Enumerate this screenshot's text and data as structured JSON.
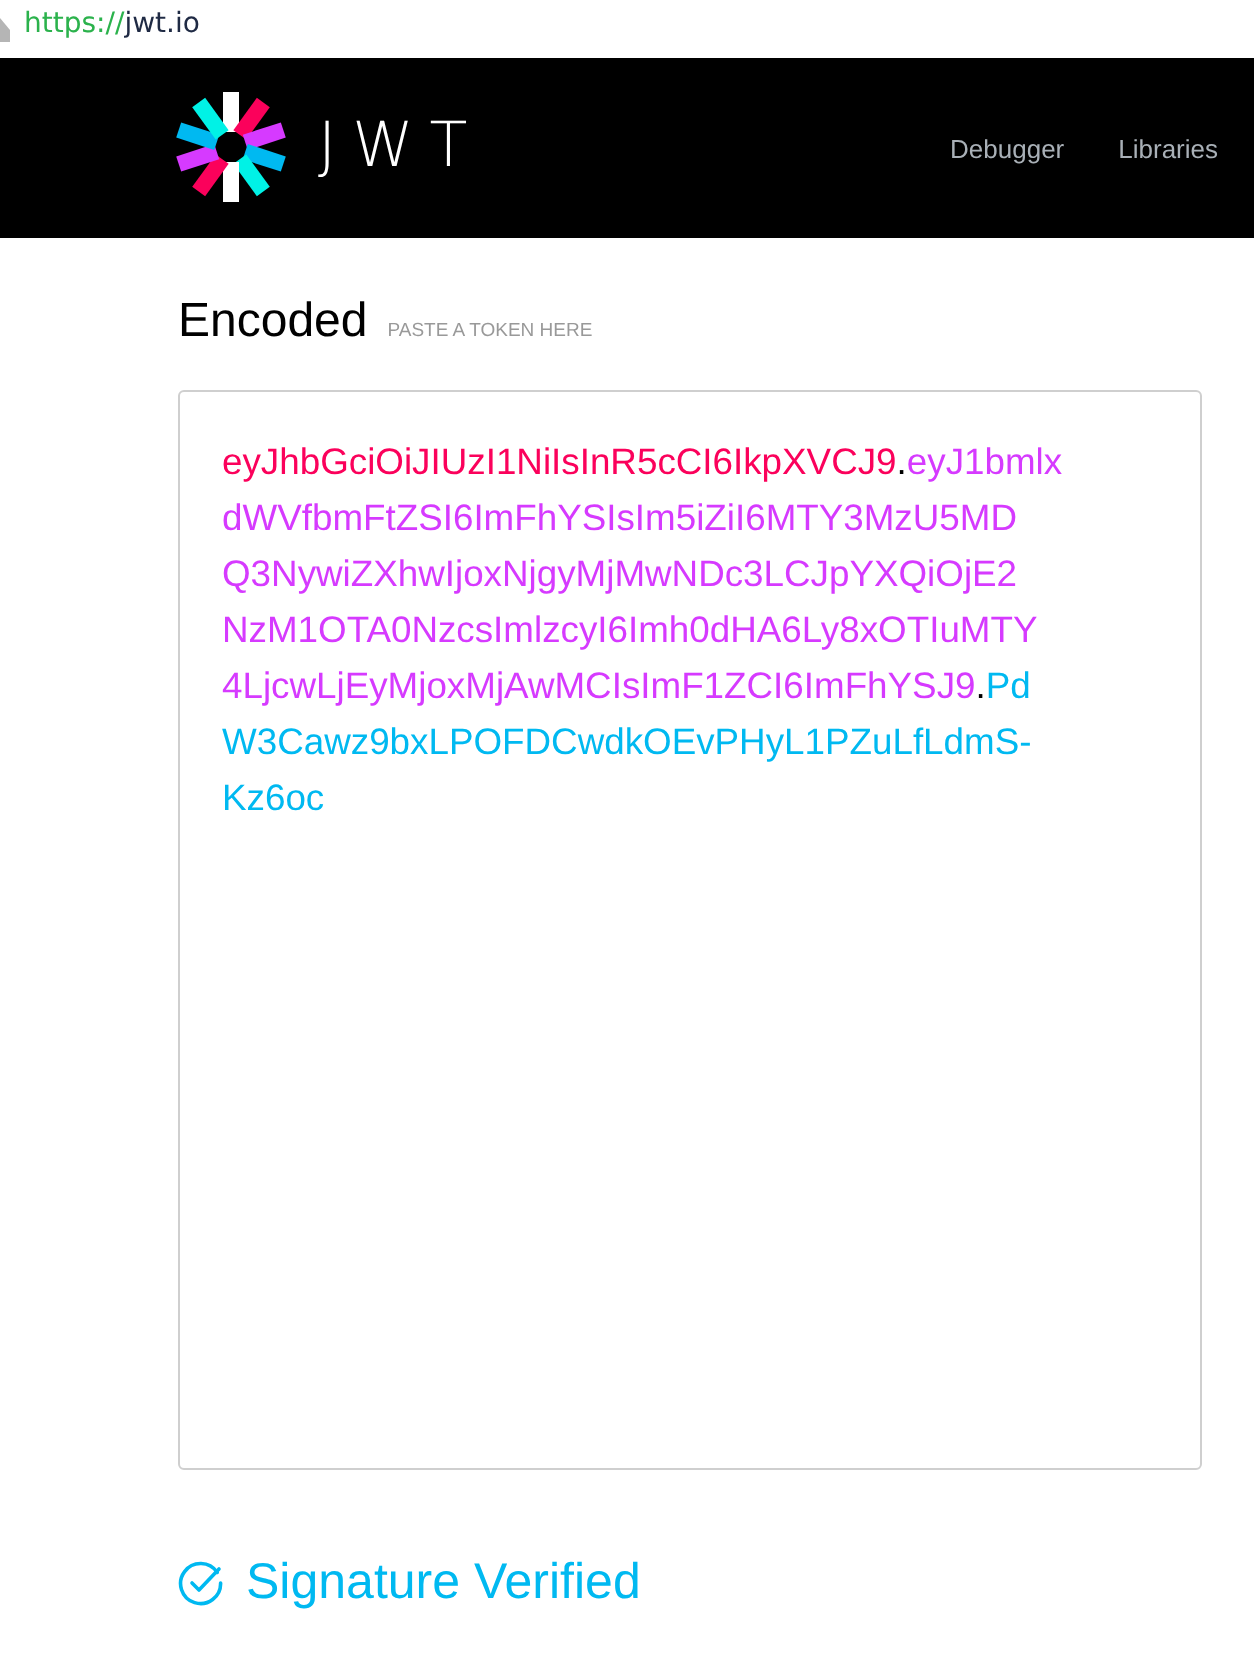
{
  "address_bar": {
    "scheme": "https://",
    "host": "jwt.io"
  },
  "header": {
    "logo_text": "JWT",
    "nav": [
      {
        "label": "Debugger"
      },
      {
        "label": "Libraries"
      }
    ]
  },
  "encoded": {
    "title": "Encoded",
    "hint": "PASTE A TOKEN HERE",
    "lines": [
      [
        {
          "color": "#fb015b",
          "text": "eyJhbGciOiJIUzI1NiIsInR5cCI6IkpXVCJ9"
        },
        {
          "color": "#000000",
          "text": "."
        },
        {
          "color": "#d63aff",
          "text": "eyJ1bmlx"
        }
      ],
      [
        {
          "color": "#d63aff",
          "text": "dWVfbmFtZSI6ImFhYSIsIm5iZiI6MTY3MzU5MD"
        }
      ],
      [
        {
          "color": "#d63aff",
          "text": "Q3NywiZXhwIjoxNjgyMjMwNDc3LCJpYXQiOjE2"
        }
      ],
      [
        {
          "color": "#d63aff",
          "text": "NzM1OTA0NzcsImlzcyI6Imh0dHA6Ly8xOTIuMTY"
        }
      ],
      [
        {
          "color": "#d63aff",
          "text": "4LjcwLjEyMjoxMjAwMCIsImF1ZCI6ImFhYSJ9"
        },
        {
          "color": "#000000",
          "text": "."
        },
        {
          "color": "#00b9f1",
          "text": "Pd"
        }
      ],
      [
        {
          "color": "#00b9f1",
          "text": "W3Cawz9bxLPOFDCwdkOEvPHyL1PZuLfLdmS-"
        }
      ],
      [
        {
          "color": "#00b9f1",
          "text": "Kz6oc"
        }
      ]
    ]
  },
  "status": {
    "verified": true,
    "text": "Signature Verified"
  }
}
